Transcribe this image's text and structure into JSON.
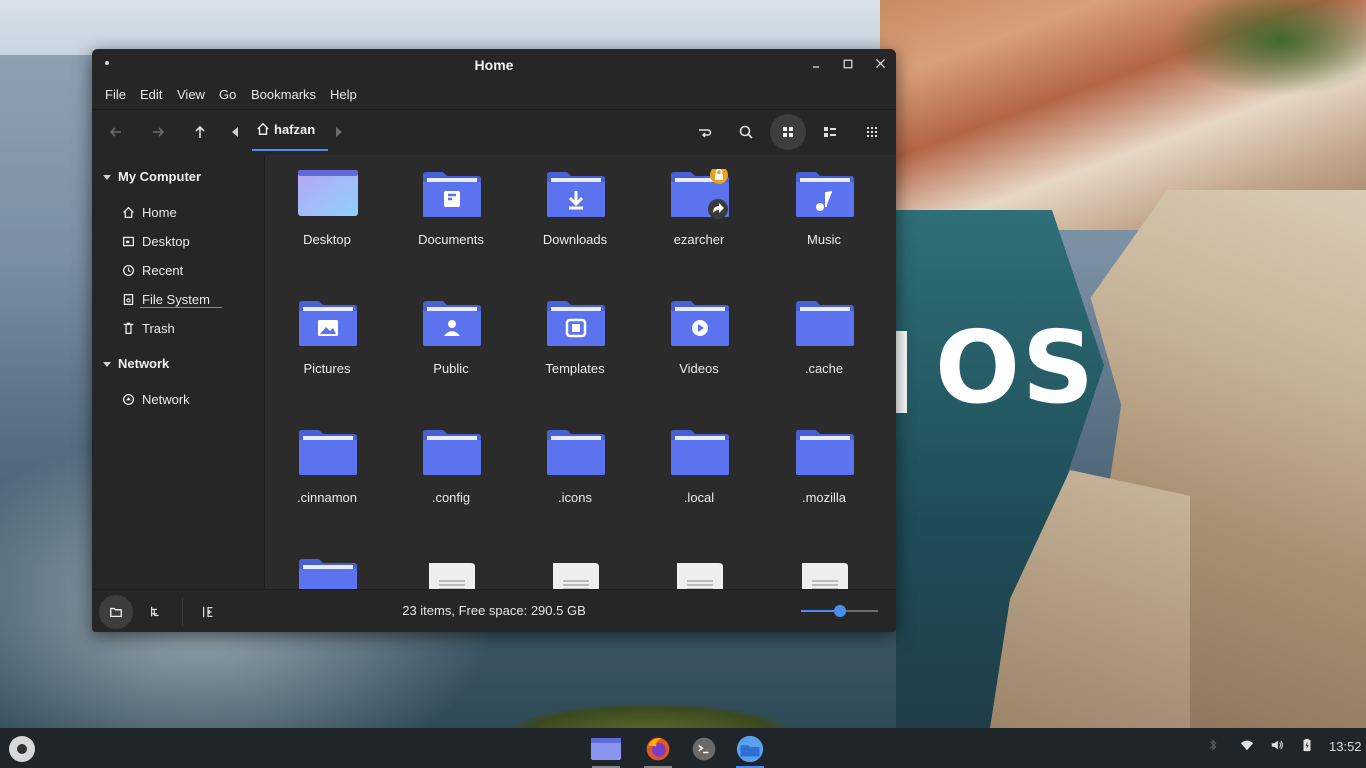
{
  "wallpaper": {
    "logo_text": "OS"
  },
  "window": {
    "title": "Home",
    "controls": {
      "minimize": "–",
      "maximize": "□",
      "close": "✕"
    }
  },
  "menubar": [
    "File",
    "Edit",
    "View",
    "Go",
    "Bookmarks",
    "Help"
  ],
  "toolbar": {
    "breadcrumb": "hafzan",
    "icons": [
      "back-arrow-icon",
      "forward-arrow-icon",
      "up-arrow-icon",
      "toggle-location-icon",
      "search-icon",
      "icon-view-icon",
      "list-view-icon",
      "compact-view-icon"
    ],
    "active_view": "icon-view"
  },
  "sidebar": {
    "sections": [
      {
        "title": "My Computer",
        "items": [
          "Home",
          "Desktop",
          "Recent",
          "File System",
          "Trash"
        ]
      },
      {
        "title": "Network",
        "items": [
          "Network"
        ]
      }
    ]
  },
  "files": [
    {
      "name": "Desktop",
      "kind": "desktop"
    },
    {
      "name": "Documents",
      "kind": "documents"
    },
    {
      "name": "Downloads",
      "kind": "downloads"
    },
    {
      "name": "ezarcher",
      "kind": "link-locked"
    },
    {
      "name": "Music",
      "kind": "music"
    },
    {
      "name": "Pictures",
      "kind": "pictures"
    },
    {
      "name": "Public",
      "kind": "public"
    },
    {
      "name": "Templates",
      "kind": "templates"
    },
    {
      "name": "Videos",
      "kind": "videos"
    },
    {
      "name": ".cache",
      "kind": "folder"
    },
    {
      "name": ".cinnamon",
      "kind": "folder"
    },
    {
      "name": ".config",
      "kind": "folder"
    },
    {
      "name": ".icons",
      "kind": "folder"
    },
    {
      "name": ".local",
      "kind": "folder"
    },
    {
      "name": ".mozilla",
      "kind": "folder"
    },
    {
      "name": "",
      "kind": "folder"
    },
    {
      "name": "",
      "kind": "text-file"
    },
    {
      "name": "",
      "kind": "text-file"
    },
    {
      "name": "",
      "kind": "text-file"
    },
    {
      "name": "",
      "kind": "text-file"
    }
  ],
  "statusbar": {
    "text": "23 items, Free space: 290.5 GB",
    "zoom_level": 0.5
  },
  "taskbar": {
    "apps": [
      "files",
      "firefox",
      "terminal",
      "file-manager"
    ],
    "active_app": "file-manager",
    "clock": "13:52",
    "tray_icons": [
      "bluetooth-icon",
      "wifi-icon",
      "volume-icon",
      "battery-icon"
    ]
  },
  "colors": {
    "accent": "#4b8ef0",
    "folder": "#5b73ee",
    "folder_dark": "#4a60d6",
    "lock_badge": "#f0a020"
  }
}
